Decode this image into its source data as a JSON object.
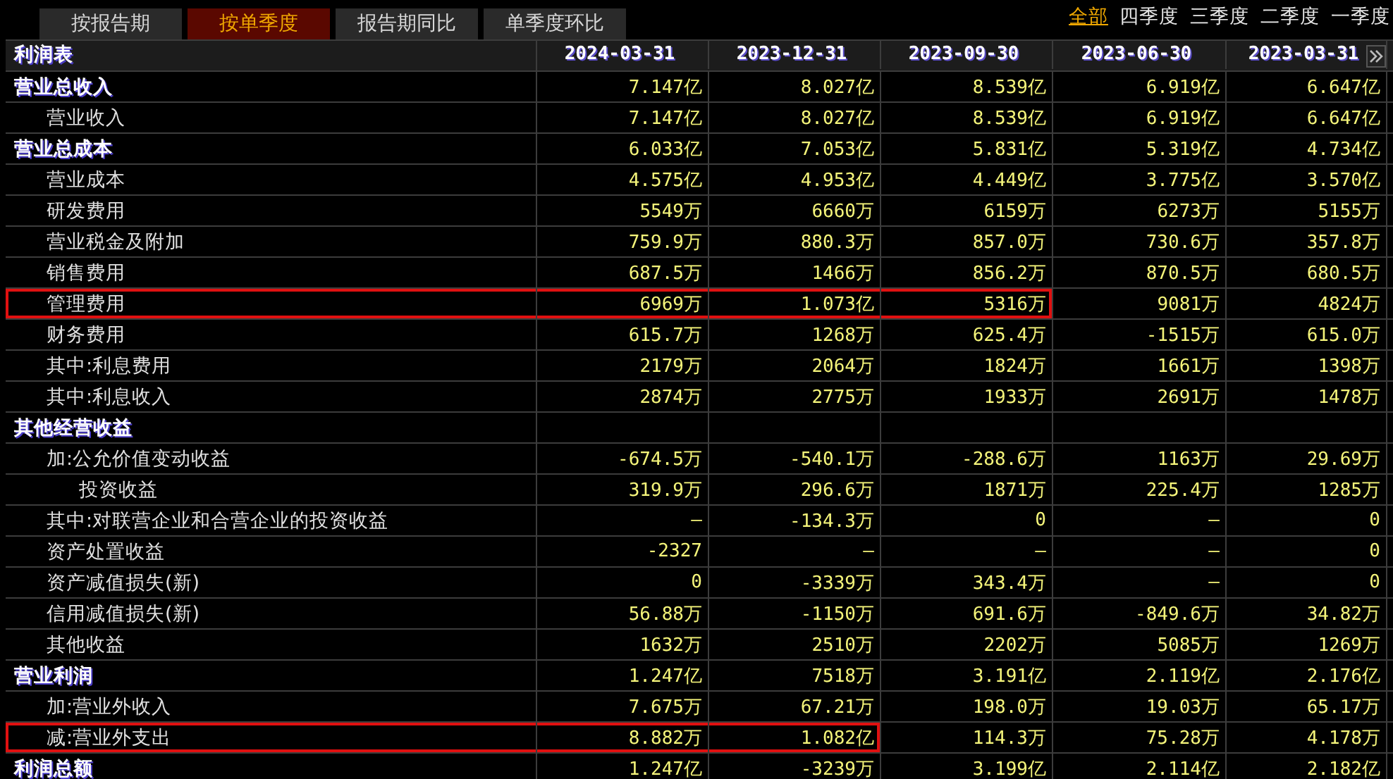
{
  "tabs": [
    {
      "label": "按报告期",
      "selected": false
    },
    {
      "label": "按单季度",
      "selected": true
    },
    {
      "label": "报告期同比",
      "selected": false
    },
    {
      "label": "单季度环比",
      "selected": false
    }
  ],
  "filters": [
    {
      "label": "全部",
      "selected": true
    },
    {
      "label": "四季度",
      "selected": false
    },
    {
      "label": "三季度",
      "selected": false
    },
    {
      "label": "二季度",
      "selected": false
    },
    {
      "label": "一季度",
      "selected": false
    }
  ],
  "table": {
    "title": "利润表",
    "columns": [
      "2024-03-31",
      "2023-12-31",
      "2023-09-30",
      "2023-06-30",
      "2023-03-31"
    ],
    "rows": [
      {
        "label": "营业总收入",
        "outlined": false,
        "values": [
          "7.147亿",
          "8.027亿",
          "8.539亿",
          "6.919亿",
          "6.647亿"
        ],
        "children": [
          {
            "label": "营业收入",
            "outlined": false,
            "values": [
              "7.147亿",
              "8.027亿",
              "8.539亿",
              "6.919亿",
              "6.647亿"
            ]
          }
        ]
      },
      {
        "label": "营业总成本",
        "outlined": false,
        "values": [
          "6.033亿",
          "7.053亿",
          "5.831亿",
          "5.319亿",
          "4.734亿"
        ],
        "children": [
          {
            "label": "营业成本",
            "outlined": false,
            "values": [
              "4.575亿",
              "4.953亿",
              "4.449亿",
              "3.775亿",
              "3.570亿"
            ]
          },
          {
            "label": "研发费用",
            "outlined": false,
            "values": [
              "5549万",
              "6660万",
              "6159万",
              "6273万",
              "5155万"
            ]
          },
          {
            "label": "营业税金及附加",
            "outlined": false,
            "values": [
              "759.9万",
              "880.3万",
              "857.0万",
              "730.6万",
              "357.8万"
            ]
          },
          {
            "label": "销售费用",
            "outlined": false,
            "values": [
              "687.5万",
              "1466万",
              "856.2万",
              "870.5万",
              "680.5万"
            ]
          },
          {
            "label": "管理费用",
            "outlined": true,
            "outline_cells": [
              true,
              true,
              true,
              false,
              false
            ],
            "values": [
              "6969万",
              "1.073亿",
              "5316万",
              "9081万",
              "4824万"
            ]
          },
          {
            "label": "财务费用",
            "outlined": false,
            "values": [
              "615.7万",
              "1268万",
              "625.4万",
              "-1515万",
              "615.0万"
            ]
          },
          {
            "label": "其中:利息费用",
            "outlined": false,
            "values": [
              "2179万",
              "2064万",
              "1824万",
              "1661万",
              "1398万"
            ]
          },
          {
            "label": "其中:利息收入",
            "outlined": false,
            "values": [
              "2874万",
              "2775万",
              "1933万",
              "2691万",
              "1478万"
            ]
          }
        ]
      },
      {
        "label": "其他经营收益",
        "outlined": false,
        "values": [],
        "children": [
          {
            "label": "加:公允价值变动收益",
            "outlined": false,
            "values": [
              "-674.5万",
              "-540.1万",
              "-288.6万",
              "1163万",
              "29.69万"
            ],
            "children": [
              {
                "label": "投资收益",
                "outlined": false,
                "values": [
                  "319.9万",
                  "296.6万",
                  "1871万",
                  "225.4万",
                  "1285万"
                ]
              }
            ]
          },
          {
            "label": "其中:对联营企业和合营企业的投资收益",
            "outlined": false,
            "values": [
              "—",
              "-134.3万",
              "0",
              "—",
              "0"
            ]
          },
          {
            "label": "资产处置收益",
            "outlined": false,
            "values": [
              "-2327",
              "—",
              "—",
              "—",
              "0"
            ]
          },
          {
            "label": "资产减值损失(新)",
            "outlined": false,
            "values": [
              "0",
              "-3339万",
              "343.4万",
              "—",
              "0"
            ]
          },
          {
            "label": "信用减值损失(新)",
            "outlined": false,
            "values": [
              "56.88万",
              "-1150万",
              "691.6万",
              "-849.6万",
              "34.82万"
            ]
          },
          {
            "label": "其他收益",
            "outlined": false,
            "values": [
              "1632万",
              "2510万",
              "2202万",
              "5085万",
              "1269万"
            ]
          }
        ]
      },
      {
        "label": "营业利润",
        "outlined": false,
        "values": [
          "1.247亿",
          "7518万",
          "3.191亿",
          "2.119亿",
          "2.176亿"
        ],
        "children": [
          {
            "label": "加:营业外收入",
            "outlined": false,
            "values": [
              "7.675万",
              "67.21万",
              "198.0万",
              "19.03万",
              "65.17万"
            ]
          },
          {
            "label": "减:营业外支出",
            "outlined": true,
            "outline_cells": [
              true,
              true,
              false,
              false,
              false
            ],
            "values": [
              "8.882万",
              "1.082亿",
              "114.3万",
              "75.28万",
              "4.178万"
            ]
          }
        ]
      },
      {
        "label": "利润总额",
        "outlined": false,
        "values": [
          "1.247亿",
          "-3239万",
          "3.199亿",
          "2.114亿",
          "2.182亿"
        ]
      }
    ]
  }
}
